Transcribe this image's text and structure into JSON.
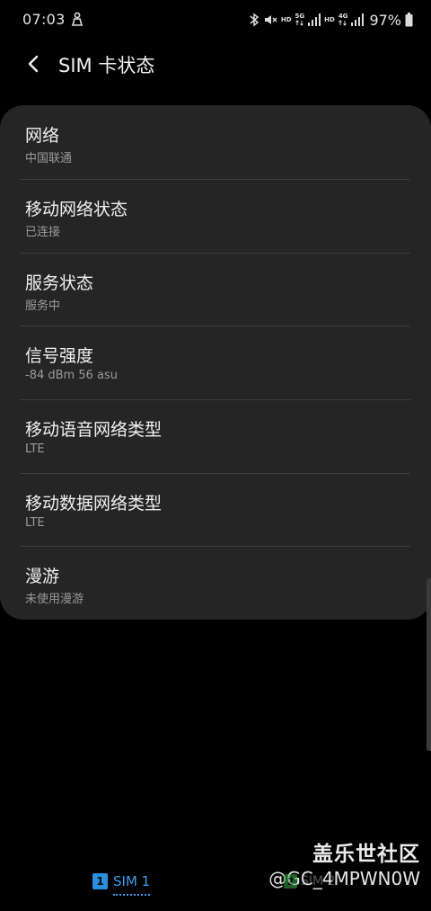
{
  "status_bar": {
    "time": "07:03",
    "network_hd_1": "HD",
    "network_5g": "5G",
    "network_hd_2": "HD",
    "network_4g": "4G",
    "battery": "97%"
  },
  "header": {
    "title": "SIM 卡状态"
  },
  "items": [
    {
      "title": "网络",
      "value": "中国联通"
    },
    {
      "title": "移动网络状态",
      "value": "已连接"
    },
    {
      "title": "服务状态",
      "value": "服务中"
    },
    {
      "title": "信号强度",
      "value": "-84 dBm 56 asu"
    },
    {
      "title": "移动语音网络类型",
      "value": "LTE"
    },
    {
      "title": "移动数据网络类型",
      "value": "LTE"
    },
    {
      "title": "漫游",
      "value": "未使用漫游"
    }
  ],
  "tabs": {
    "sim1_badge": "1",
    "sim1_label": "SIM 1",
    "sim2_badge": "2",
    "sim2_label": "SIM 2"
  },
  "watermark": {
    "title": "盖乐世社区",
    "handle": "@GC_4MPWN0W"
  },
  "colors": {
    "background": "#000000",
    "card": "#252525",
    "accent_sim1": "#3d9cf0",
    "accent_sim2": "#3aa94a"
  }
}
